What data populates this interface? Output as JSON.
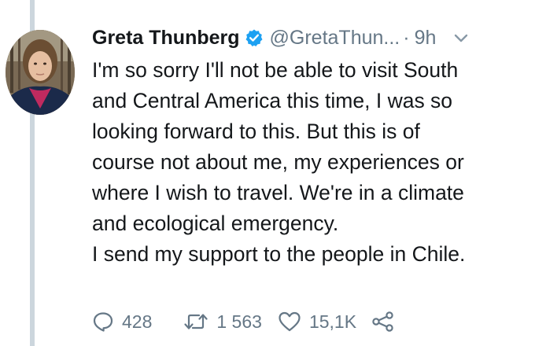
{
  "tweet": {
    "author": {
      "display_name": "Greta Thunberg",
      "handle": "@GretaThun...",
      "verified": true,
      "avatar": "profile-photo"
    },
    "separator": "·",
    "timestamp": "9h",
    "text_lines": [
      "I'm so sorry I'll not be able to visit South",
      "and Central America this time, I was so",
      "looking forward to this. But this is of",
      "course not about me, my experiences or",
      "where I wish to travel. We're in a climate",
      "and ecological emergency.",
      "I send my support to the people in Chile."
    ],
    "actions": {
      "reply_count": "428",
      "retweet_count": "1 563",
      "like_count": "15,1K",
      "share_icon": "share-icon"
    }
  },
  "colors": {
    "text": "#14171a",
    "muted": "#657786",
    "verified": "#1da1f2",
    "thread_line": "#ccd6dd"
  }
}
